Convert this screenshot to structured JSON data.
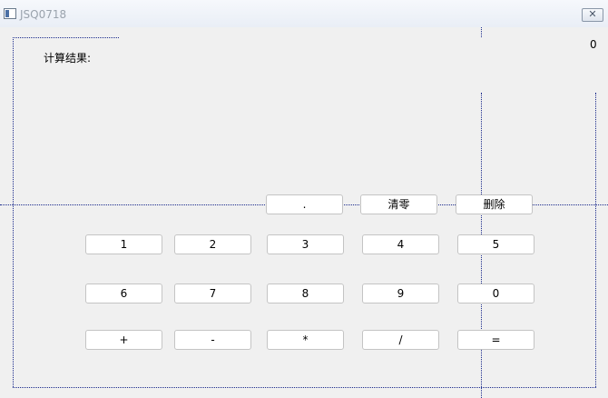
{
  "window": {
    "title": "JSQ0718",
    "close_label": "✕"
  },
  "result": {
    "label": "计算结果:",
    "value": "0"
  },
  "row_top": [
    ".",
    "清零",
    "删除"
  ],
  "row1": [
    "1",
    "2",
    "3",
    "4",
    "5"
  ],
  "row2": [
    "6",
    "7",
    "8",
    "9",
    "0"
  ],
  "row3": [
    "+",
    "-",
    "*",
    "/",
    "="
  ]
}
